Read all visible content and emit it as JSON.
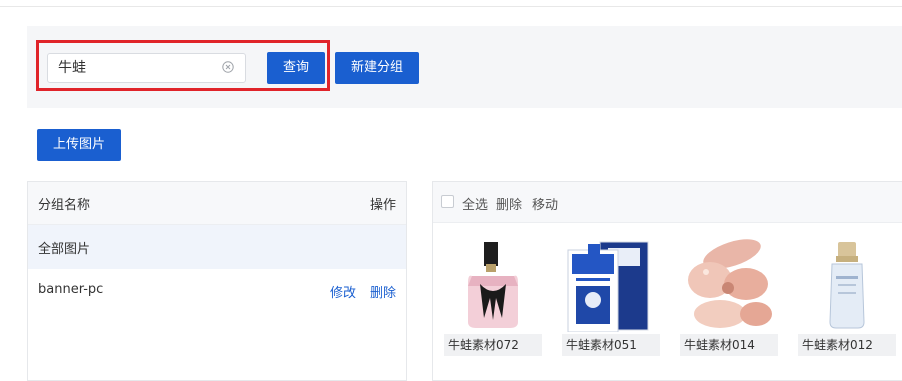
{
  "search": {
    "value": "牛蛙",
    "query_label": "查询",
    "new_group_label": "新建分组"
  },
  "upload_label": "上传图片",
  "groups": {
    "header_name": "分组名称",
    "header_action": "操作",
    "items": [
      {
        "name": "全部图片"
      },
      {
        "name": "banner-pc",
        "edit_label": "修改",
        "delete_label": "删除"
      }
    ]
  },
  "images": {
    "toolbar": {
      "select_all": "全选",
      "delete": "删除",
      "move": "移动"
    },
    "items": [
      {
        "label": "牛蛙素材072",
        "icon": "perfume-bottle-image"
      },
      {
        "label": "牛蛙素材051",
        "icon": "face-mask-pack-image"
      },
      {
        "label": "牛蛙素材014",
        "icon": "pink-perfume-image"
      },
      {
        "label": "牛蛙素材012",
        "icon": "serum-bottle-image"
      }
    ]
  },
  "colors": {
    "primary": "#1a5fd0",
    "highlight": "#e0242a"
  }
}
